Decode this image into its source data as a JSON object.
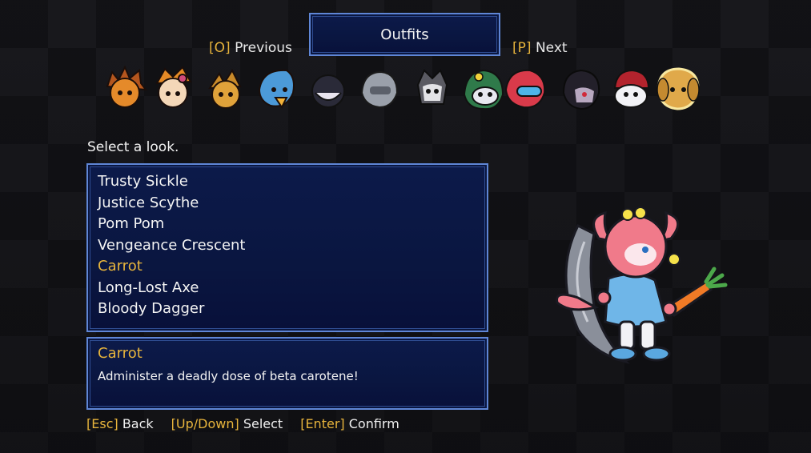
{
  "header": {
    "title": "Outfits",
    "prev_key": "[O]",
    "prev_label": "Previous",
    "next_key": "[P]",
    "next_label": "Next"
  },
  "portraits": [
    {
      "name": "portrait-brown-spiky",
      "hair": "#b4561e"
    },
    {
      "name": "portrait-orange-goggles",
      "hair": "#e58a26"
    },
    {
      "name": "portrait-tan-fox",
      "hair": "#c98a2a"
    },
    {
      "name": "portrait-blue-bird",
      "hair": "#4c9ad8"
    },
    {
      "name": "portrait-dark-hair",
      "hair": "#2a2a38"
    },
    {
      "name": "portrait-gray-helmet",
      "hair": "#9aa0aa"
    },
    {
      "name": "portrait-skull-mask",
      "hair": "#5a5a62"
    },
    {
      "name": "portrait-green-hood",
      "hair": "#2f7a4a"
    },
    {
      "name": "portrait-red-tech",
      "hair": "#d93a4a"
    },
    {
      "name": "portrait-black-hair",
      "hair": "#23202a"
    },
    {
      "name": "portrait-red-cap",
      "hair": "#b3232d"
    },
    {
      "name": "portrait-golden-dog",
      "hair": "#e0a94a"
    }
  ],
  "prompt": "Select a look.",
  "outfits": {
    "items": [
      "Trusty Sickle",
      "Justice Scythe",
      "Pom Pom",
      "Vengeance Crescent",
      "Carrot",
      "Long-Lost Axe",
      "Bloody Dagger"
    ],
    "selected_index": 4
  },
  "description": {
    "title": "Carrot",
    "text": "Administer a deadly dose of beta carotene!"
  },
  "controls": {
    "back_key": "[Esc]",
    "back_label": "Back",
    "select_key": "[Up/Down]",
    "select_label": "Select",
    "confirm_key": "[Enter]",
    "confirm_label": "Confirm"
  },
  "colors": {
    "accent_gold": "#e7b43c",
    "panel_blue": "#0c1a4a",
    "panel_border": "#5f86d6"
  }
}
